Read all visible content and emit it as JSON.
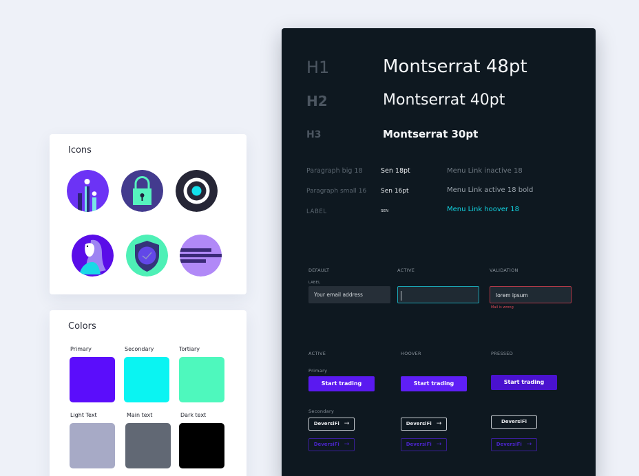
{
  "icons_card": {
    "title": "Icons",
    "icons": [
      "chart-bars-icon",
      "padlock-icon",
      "target-icon",
      "person-profile-icon",
      "shield-check-icon",
      "text-lines-icon"
    ]
  },
  "colors_card": {
    "title": "Colors",
    "swatches": [
      {
        "label": "Primary",
        "color": "#5b0dfb"
      },
      {
        "label": "Secondary",
        "color": "#0af4f2"
      },
      {
        "label": "Tortiary",
        "color": "#4ef8bd"
      },
      {
        "label": "Light Text",
        "color": "#a7aac6"
      },
      {
        "label": "Main text",
        "color": "#616874"
      },
      {
        "label": "Dark text",
        "color": "#000000"
      }
    ]
  },
  "typography": {
    "headings": [
      {
        "key": "H1",
        "value": "Montserrat 48pt"
      },
      {
        "key": "H2",
        "value": "Montserrat 40pt"
      },
      {
        "key": "H3",
        "value": "Montserrat 30pt"
      }
    ],
    "rows": [
      {
        "name": "Paragraph big 18",
        "spec": "Sen 18pt",
        "menu": "Menu Link inactive 18"
      },
      {
        "name": "Paragraph small 16",
        "spec": "Sen 16pt",
        "menu": "Menu Link active 18 bold"
      },
      {
        "name": "LABEL",
        "spec": "SEN",
        "menu": "Menu Link hoover 18"
      }
    ]
  },
  "inputs": {
    "states": [
      "DEFAULT",
      "ACTIVE",
      "VALIDATION"
    ],
    "field_label": "LABEL",
    "default_placeholder": "Your email address",
    "validation_value": "lorem ipsum",
    "error_text": "Mail is wrong"
  },
  "buttons": {
    "states": [
      "ACTIVE",
      "HOOVER",
      "PRESSED"
    ],
    "primary_label": "Primary",
    "primary_text": "Start trading",
    "secondary_label": "Secondary",
    "secondary_text": "DeversiFi",
    "arrow": "→"
  },
  "colors": {
    "accent": "#5a19f0",
    "cyan": "#12d6e3",
    "error": "#e04a57",
    "panel": "#0e1820"
  }
}
